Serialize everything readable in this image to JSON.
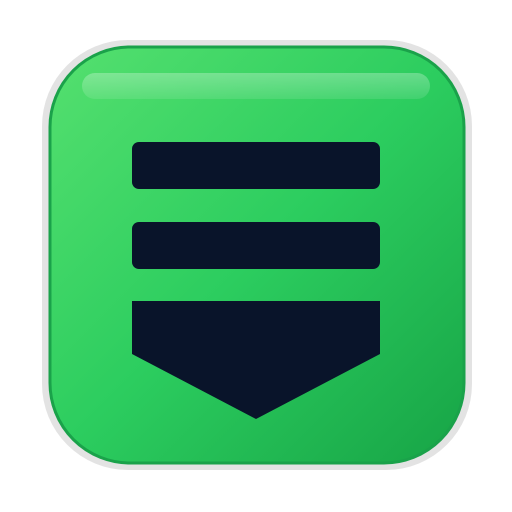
{
  "app_icon": {
    "icon_name": "download-list-app-icon",
    "glyph_icon": "stacked-bars-arrow-down-icon",
    "colors": {
      "outer_ring": "#e3e3e3",
      "tile_light": "#55e06f",
      "tile_mid": "#2ccd5f",
      "tile_dark": "#17a446",
      "tile_edge": "#1aa24a",
      "highlight": "#ffffff",
      "glyph": "#09142a"
    }
  }
}
